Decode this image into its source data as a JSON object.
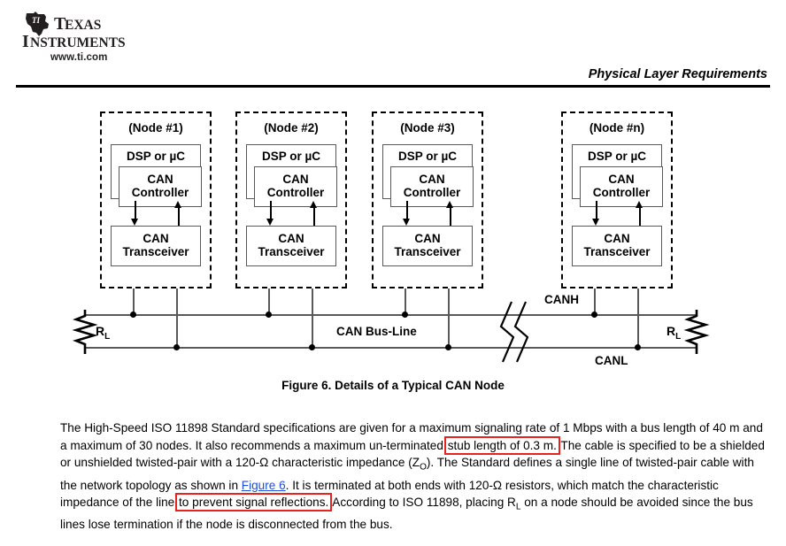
{
  "header": {
    "logo_name": "Texas Instruments",
    "logo_line1": "TEXAS",
    "logo_line2": "INSTRUMENTS",
    "url": "www.ti.com",
    "section_title": "Physical Layer Requirements"
  },
  "figure": {
    "caption": "Figure 6. Details of a Typical CAN Node",
    "bus_label": "CAN Bus-Line",
    "canh_label": "CANH",
    "canl_label": "CANL",
    "terminator_left": "R",
    "terminator_left_sub": "L",
    "terminator_right": "R",
    "terminator_right_sub": "L",
    "nodes": [
      {
        "title": "(Node #1)",
        "dsp": "DSP or µC",
        "controller_line1": "CAN",
        "controller_line2": "Controller",
        "transceiver_line1": "CAN",
        "transceiver_line2": "Transceiver"
      },
      {
        "title": "(Node #2)",
        "dsp": "DSP or µC",
        "controller_line1": "CAN",
        "controller_line2": "Controller",
        "transceiver_line1": "CAN",
        "transceiver_line2": "Transceiver"
      },
      {
        "title": "(Node #3)",
        "dsp": "DSP or µC",
        "controller_line1": "CAN",
        "controller_line2": "Controller",
        "transceiver_line1": "CAN",
        "transceiver_line2": "Transceiver"
      },
      {
        "title": "(Node #n)",
        "dsp": "DSP or µC",
        "controller_line1": "CAN",
        "controller_line2": "Controller",
        "transceiver_line1": "CAN",
        "transceiver_line2": "Transceiver"
      }
    ]
  },
  "body": {
    "seg1": "The High-Speed ISO 11898 Standard specifications are given for a maximum signaling rate of 1 Mbps with a bus length of 40 m and a maximum of 30 nodes. It also recommends a maximum un-terminated ",
    "highlight1": "stub length of 0.3 m.",
    "seg2": " The cable is specified to be a shielded or unshielded twisted-pair with a 120-Ω characteristic impedance (Z",
    "sub_o": "O",
    "seg3": "). The Standard defines a single line of twisted-pair cable with the network topology as shown in ",
    "link_figure": "Figure 6",
    "seg4": ". It is terminated at both ends with 120-Ω resistors, which match the characteristic impedance of the line ",
    "highlight2": "to prevent signal reflections.",
    "seg5": " According to ISO 11898, placing R",
    "sub_l": "L",
    "seg6": " on a node should be avoided since the bus lines lose termination if the node is disconnected from the bus."
  },
  "colors": {
    "highlight_red": "#e8221f",
    "link_blue": "#1f4fd8",
    "rule_black": "#000000",
    "box_gray": "#58595b"
  }
}
